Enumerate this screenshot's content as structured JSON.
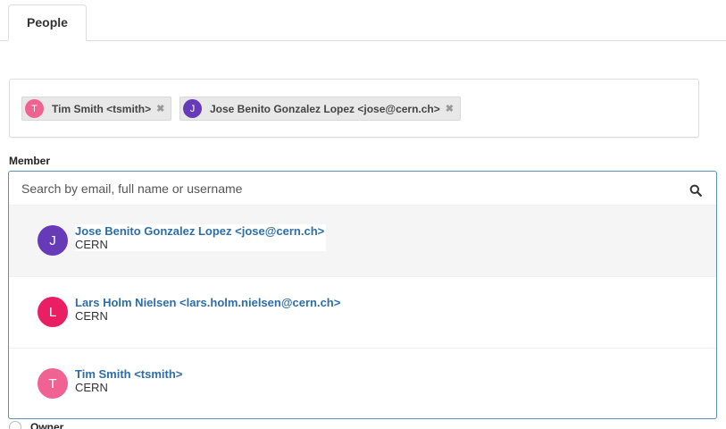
{
  "tabs": [
    {
      "label": "People",
      "active": true
    }
  ],
  "selected_people": [
    {
      "initial": "T",
      "label": "Tim Smith <tsmith>",
      "avatar_color": "#f06292"
    },
    {
      "initial": "J",
      "label": "Jose Benito Gonzalez Lopez <jose@cern.ch>",
      "avatar_color": "#673ab7"
    }
  ],
  "remove_icon": "close-icon",
  "member_field": {
    "label": "Member",
    "placeholder": "Search by email, full name or username",
    "value": "",
    "icon": "search-icon"
  },
  "results": [
    {
      "initial": "J",
      "name": "Jose Benito Gonzalez Lopez <jose@cern.ch>",
      "org": "CERN",
      "avatar_color": "#673ab7",
      "highlighted": true
    },
    {
      "initial": "L",
      "name": "Lars Holm Nielsen <lars.holm.nielsen@cern.ch>",
      "org": "CERN",
      "avatar_color": "#e91e63"
    },
    {
      "initial": "T",
      "name": "Tim Smith <tsmith>",
      "org": "CERN",
      "avatar_color": "#f06292"
    }
  ],
  "role_option": {
    "label": "Owner"
  }
}
